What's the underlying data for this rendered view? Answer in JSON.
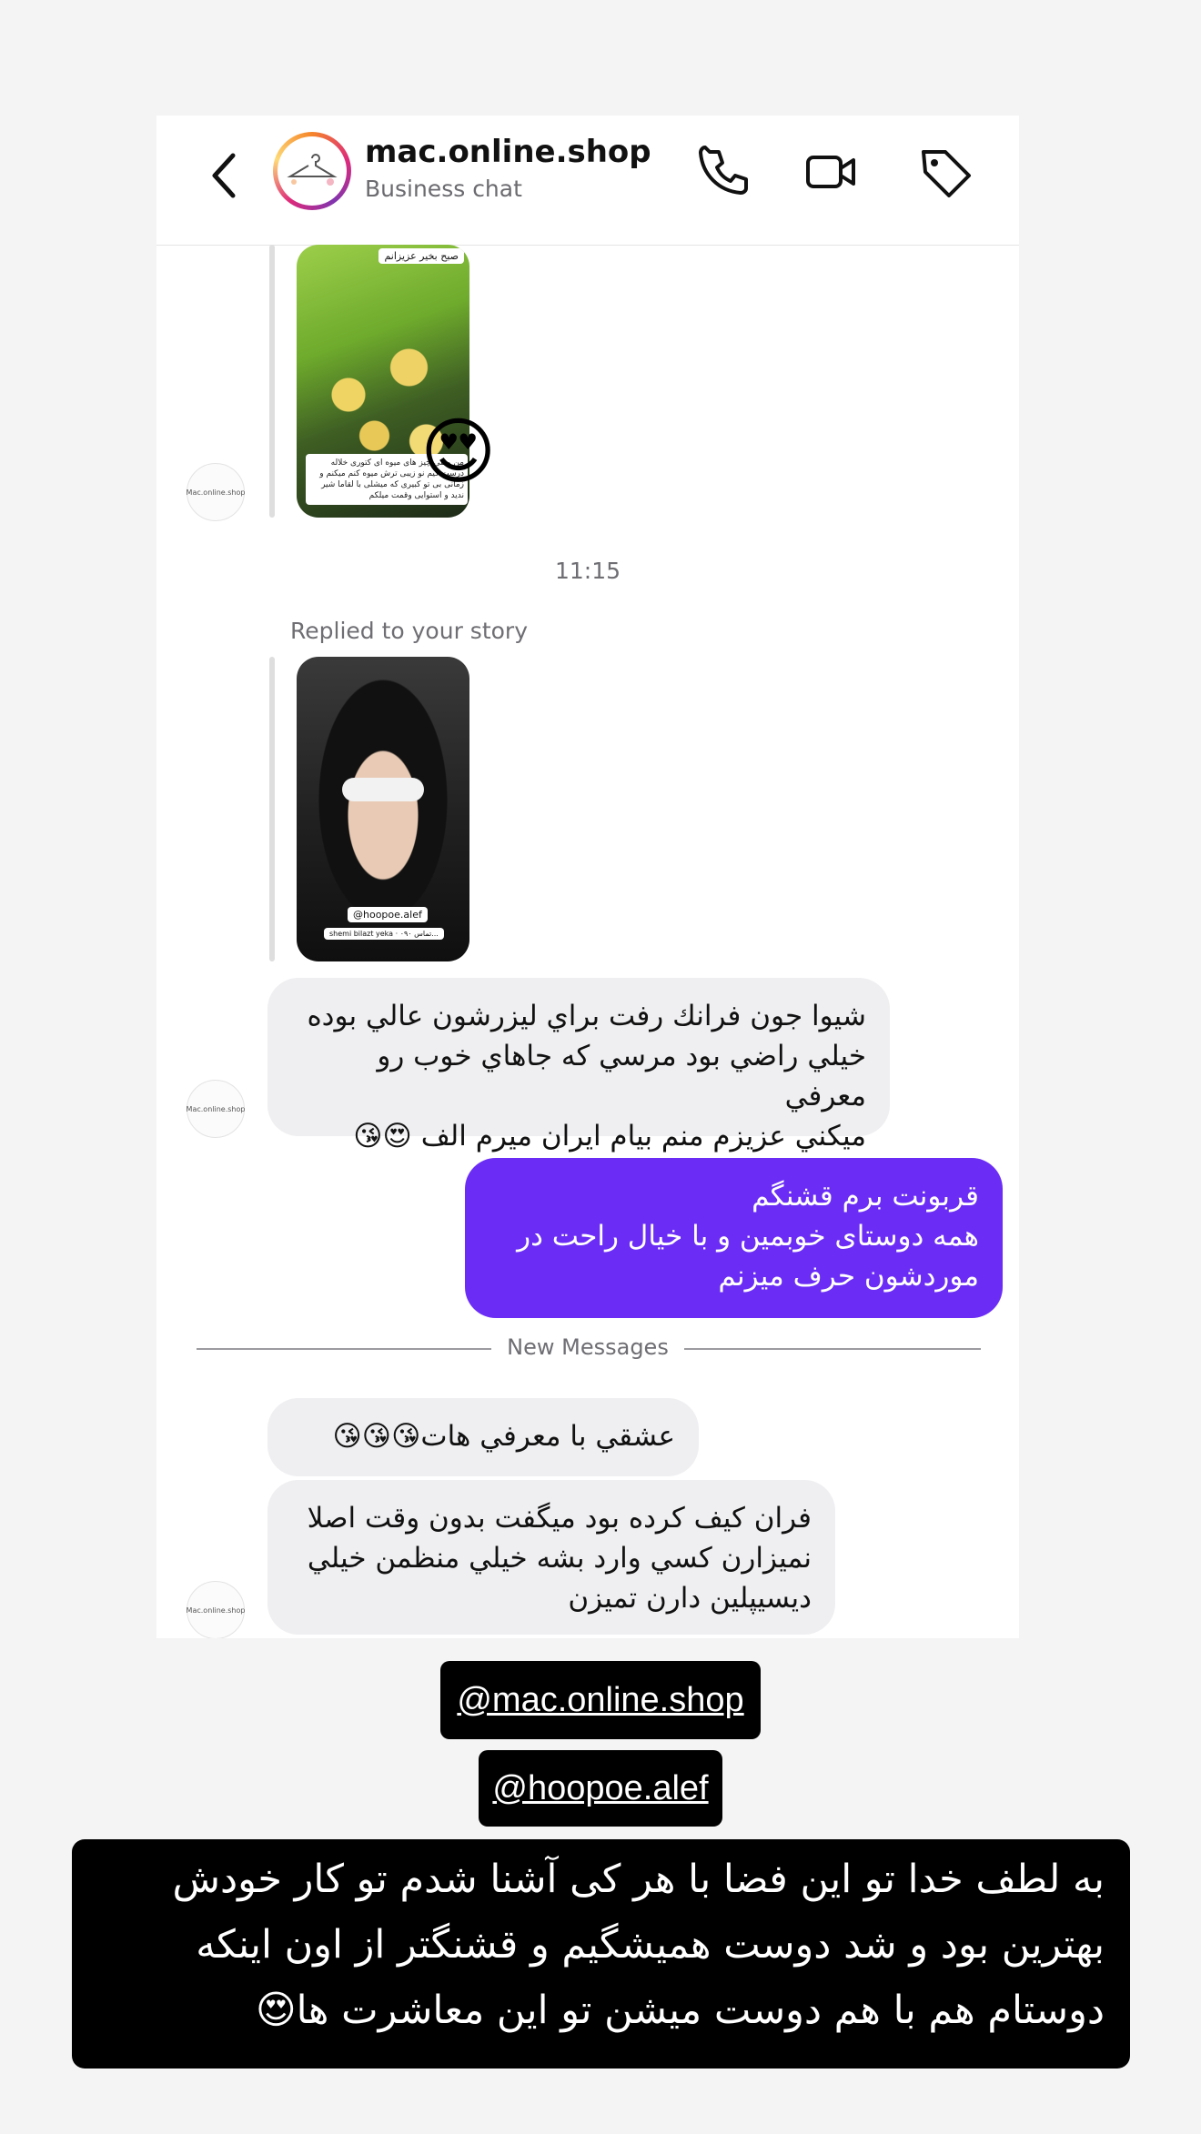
{
  "header": {
    "name": "mac.online.shop",
    "subtitle": "Business chat",
    "icons": [
      "chevron-left-icon",
      "phone-icon",
      "video-camera-icon",
      "tag-icon"
    ]
  },
  "logo_text": "Mac.online.shop",
  "story1": {
    "tag": "صبح بخیر عزیزانم",
    "text": "من وقتی چیز های میوه ای کتوری خلاله درست کیم نو زیبی ترش میوه کنم میکنم و زمانی بی تو کبیری که میشلی با لقاما شیر ندید و استوایی وقمت میلکم",
    "emoji": "😍"
  },
  "time": "11:15",
  "replied_label": "Replied to your story",
  "story2": {
    "tag": "@hoopoe.alef",
    "subtag": "shemi bilazt yeka · تماس ۰۹۰..."
  },
  "messages": {
    "m1": "شيوا جون فرانك رفت براي ليزرشون عالي بوده\nخيلي راضي بود مرسي كه جاهاي خوب رو معرفي\nميكني عزيزم منم بيام ايران ميرم الف 😍😘",
    "m2": "قربونت برم قشنگم\nهمه دوستای خوبمین و با خیال راحت در\nموردشون حرف میزنم",
    "new_messages_label": "New Messages",
    "m3": "عشقي با معرفي هات😘😘😘",
    "m4": "فران كيف كرده بود ميگفت بدون وقت اصلا\nنميزارن كسي وارد بشه خيلي منظمن خيلي\nديسيپلين دارن تميزن"
  },
  "handles": {
    "h1": "@mac.online.shop",
    "h2": "@hoopoe.alef"
  },
  "caption": "به لطف خدا تو این فضا با هر کی آشنا شدم تو کار خودش بهترین بود و شد دوست همیشگیم و قشنگتر از اون اینکه دوستام هم با هم دوست میشن تو این معاشرت ها😍",
  "colors": {
    "outgoing_bubble": "#6b2df5",
    "incoming_bubble": "#efeff2",
    "caption_bg": "#000000"
  }
}
